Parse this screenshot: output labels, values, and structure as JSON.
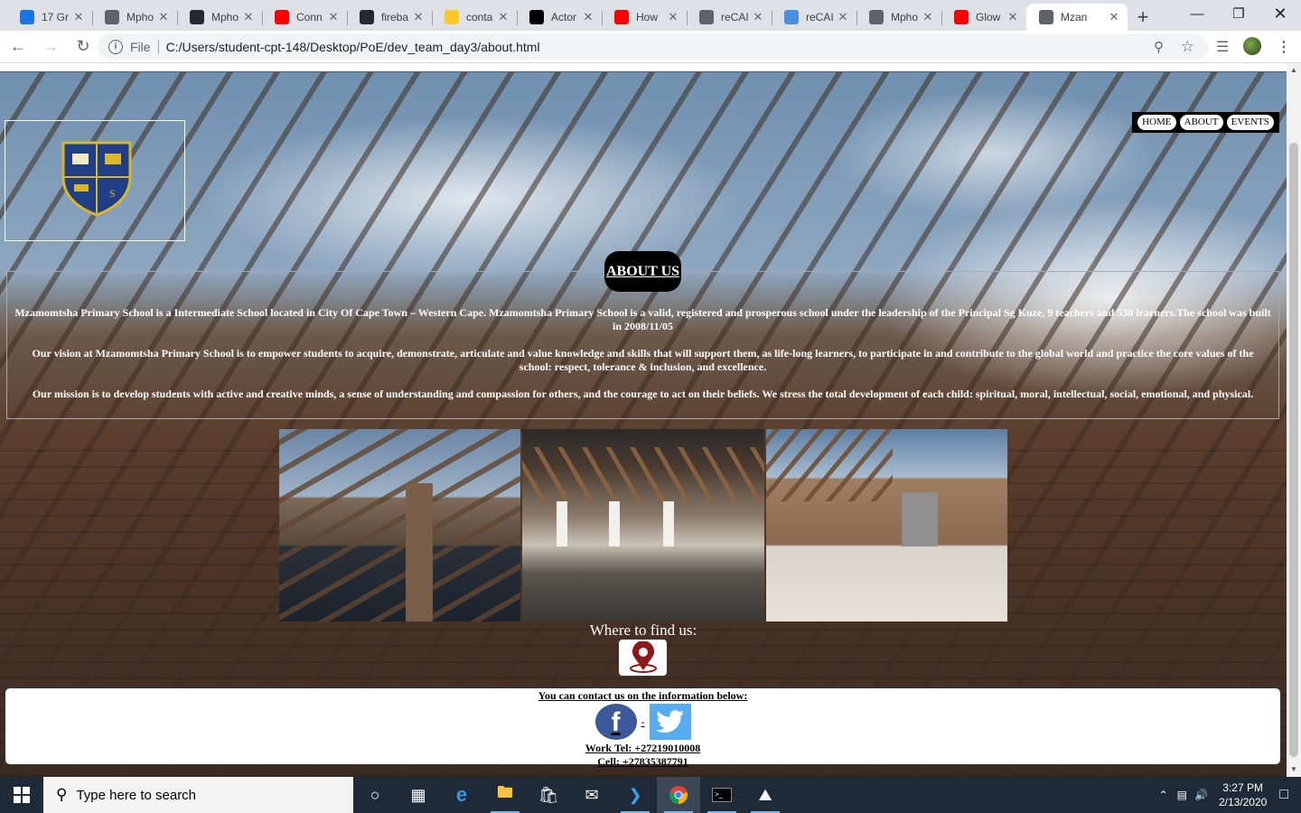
{
  "browser": {
    "tabs": [
      {
        "title": "17 Gr",
        "favicon": "calendar-favicon",
        "color": "#1a73e8"
      },
      {
        "title": "Mpho",
        "favicon": "globe-favicon",
        "color": "#5f6368"
      },
      {
        "title": "Mpho",
        "favicon": "github-favicon",
        "color": "#24292e"
      },
      {
        "title": "Conn",
        "favicon": "youtube-favicon",
        "color": "#ff0000"
      },
      {
        "title": "fireba",
        "favicon": "github-favicon",
        "color": "#24292e"
      },
      {
        "title": "conta",
        "favicon": "firebase-favicon",
        "color": "#ffca28"
      },
      {
        "title": "Actor",
        "favicon": "wix-favicon",
        "color": "#000000"
      },
      {
        "title": "How",
        "favicon": "youtube-favicon",
        "color": "#ff0000"
      },
      {
        "title": "reCAI",
        "favicon": "globe-favicon",
        "color": "#5f6368"
      },
      {
        "title": "reCAI",
        "favicon": "recaptcha-favicon",
        "color": "#4a90e2"
      },
      {
        "title": "Mpho",
        "favicon": "globe-favicon",
        "color": "#5f6368"
      },
      {
        "title": "Glow",
        "favicon": "youtube-favicon",
        "color": "#ff0000"
      },
      {
        "title": "Mzan",
        "favicon": "globe-favicon",
        "color": "#5f6368",
        "active": true
      }
    ],
    "address": {
      "protocol": "File",
      "url": "C:/Users/student-cpt-148/Desktop/PoE/dev_team_day3/about.html"
    }
  },
  "site": {
    "nav": [
      "HOME",
      "ABOUT",
      "EVENTS"
    ],
    "about_title": "ABOUT US",
    "paragraphs": [
      "Mzamomtsha Primary School is a Intermediate School located in City Of Cape Town – Western Cape. Mzamomtsha Primary School is a valid, registered and prosperous school under the leadership of the Principal Sg Kuze, 9 teachers and 530 learners.The school was built in 2008/11/05",
      "Our vision at Mzamomtsha Primary School is to empower students to acquire, demonstrate, articulate and value knowledge and skills that will support them, as life-long learners, to participate in and contribute to the global world and practice the core values of the school: respect, tolerance & inclusion, and excellence.",
      "Our mission is to develop students with active and creative minds, a sense of understanding and compassion for others, and the courage to act on their beliefs. We stress the total development of each child: spiritual, moral, intellectual, social, emotional, and physical."
    ],
    "find_us": "Where to find us:",
    "footer": {
      "heading": "You can contact us on the information below:",
      "separator": "-",
      "work_tel": "Work Tel: +27219010008",
      "cell": "Cell: +27835387791"
    }
  },
  "taskbar": {
    "search_placeholder": "Type here to search",
    "time": "3:27 PM",
    "date": "2/13/2020"
  }
}
